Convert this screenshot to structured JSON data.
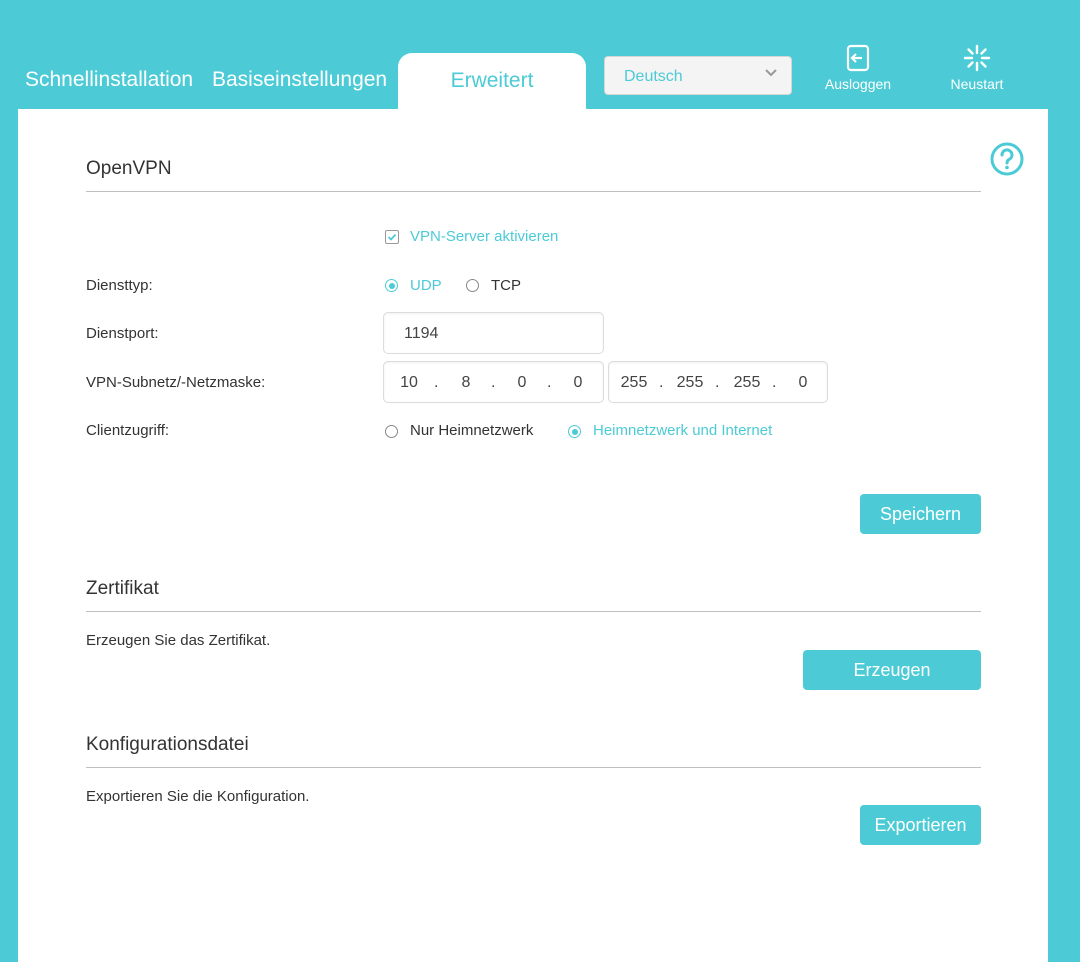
{
  "nav": {
    "quick_setup": "Schnellinstallation",
    "basic": "Basiseinstellungen",
    "advanced": "Erweitert",
    "language": "Deutsch",
    "logout": "Ausloggen",
    "reboot": "Neustart"
  },
  "openvpn": {
    "title": "OpenVPN",
    "enable_label": "VPN-Server aktivieren",
    "enable_checked": true,
    "service_type_label": "Diensttyp:",
    "service_type_options": [
      "UDP",
      "TCP"
    ],
    "service_type_selected": "UDP",
    "service_port_label": "Dienstport:",
    "service_port_value": "1194",
    "subnet_label": "VPN-Subnetz/-Netzmaske:",
    "subnet": [
      "10",
      "8",
      "0",
      "0"
    ],
    "netmask": [
      "255",
      "255",
      "255",
      "0"
    ],
    "client_access_label": "Clientzugriff:",
    "client_access_options": [
      "Nur Heimnetzwerk",
      "Heimnetzwerk und Internet"
    ],
    "client_access_selected": "Heimnetzwerk und Internet",
    "save_label": "Speichern"
  },
  "certificate": {
    "title": "Zertifikat",
    "description": "Erzeugen Sie das Zertifikat.",
    "button": "Erzeugen"
  },
  "config_file": {
    "title": "Konfigurationsdatei",
    "description": "Exportieren Sie die Konfiguration.",
    "button": "Exportieren"
  },
  "colors": {
    "accent": "#4ccbd6",
    "text": "#333333"
  }
}
